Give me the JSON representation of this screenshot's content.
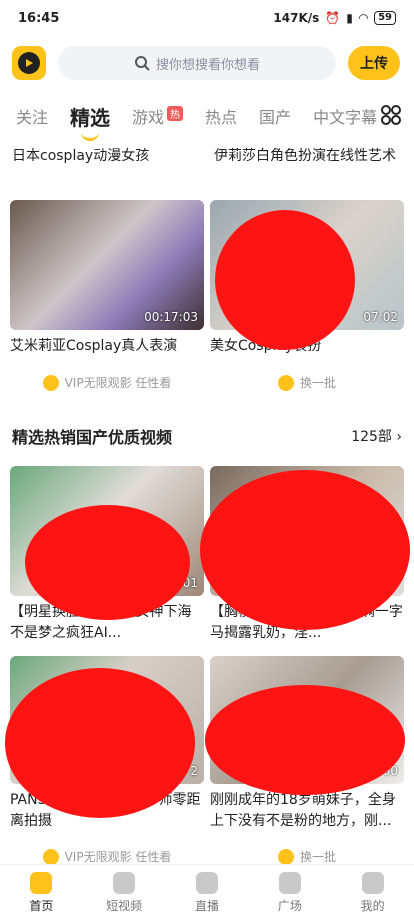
{
  "status": {
    "time": "16:45",
    "speed": "147K/s",
    "battery": "59"
  },
  "header": {
    "search_placeholder": "搜你想搜看你想看",
    "upload_label": "上传"
  },
  "tabs": [
    {
      "label": "关注"
    },
    {
      "label": "精选"
    },
    {
      "label": "游戏",
      "badge": "热"
    },
    {
      "label": "热点"
    },
    {
      "label": "国产"
    },
    {
      "label": "中文字幕"
    }
  ],
  "feed": {
    "top_titles": [
      "日本cosplay动漫女孩",
      "伊莉莎白角色扮演在线性艺术"
    ],
    "cards_a": [
      {
        "title": "艾米莉亚Cosplay真人表演",
        "duration": "00:17:03"
      },
      {
        "title": "美女Cosplay装扮",
        "duration": "07:02"
      }
    ],
    "actions_a": {
      "vip": "VIP无限观影 任性看",
      "refresh": "换一批"
    },
    "section": {
      "title": "精选热销国产优质视频",
      "count": "125部"
    },
    "cards_b": [
      {
        "title": "【明星换脸】能Al让女神下海不是梦之疯狂AI...",
        "duration": "2:01"
      },
      {
        "title": "【胸模冠军G罩杯御姐丰满一字马揭露乳奶，淫...",
        "duration": "7"
      }
    ],
    "cards_c": [
      {
        "title": "PANS女神模特掰开摄影师零距离拍摄",
        "duration": "2"
      },
      {
        "title": "刚刚成年的18岁萌妹子，全身上下没有不是粉的地方，刚...",
        "duration": "00"
      }
    ],
    "actions_b": {
      "vip": "VIP无限观影 任性看",
      "refresh": "换一批"
    }
  },
  "bottom_nav": [
    {
      "label": "首页"
    },
    {
      "label": "短视频"
    },
    {
      "label": "直播"
    },
    {
      "label": "广场"
    },
    {
      "label": "我的"
    }
  ]
}
